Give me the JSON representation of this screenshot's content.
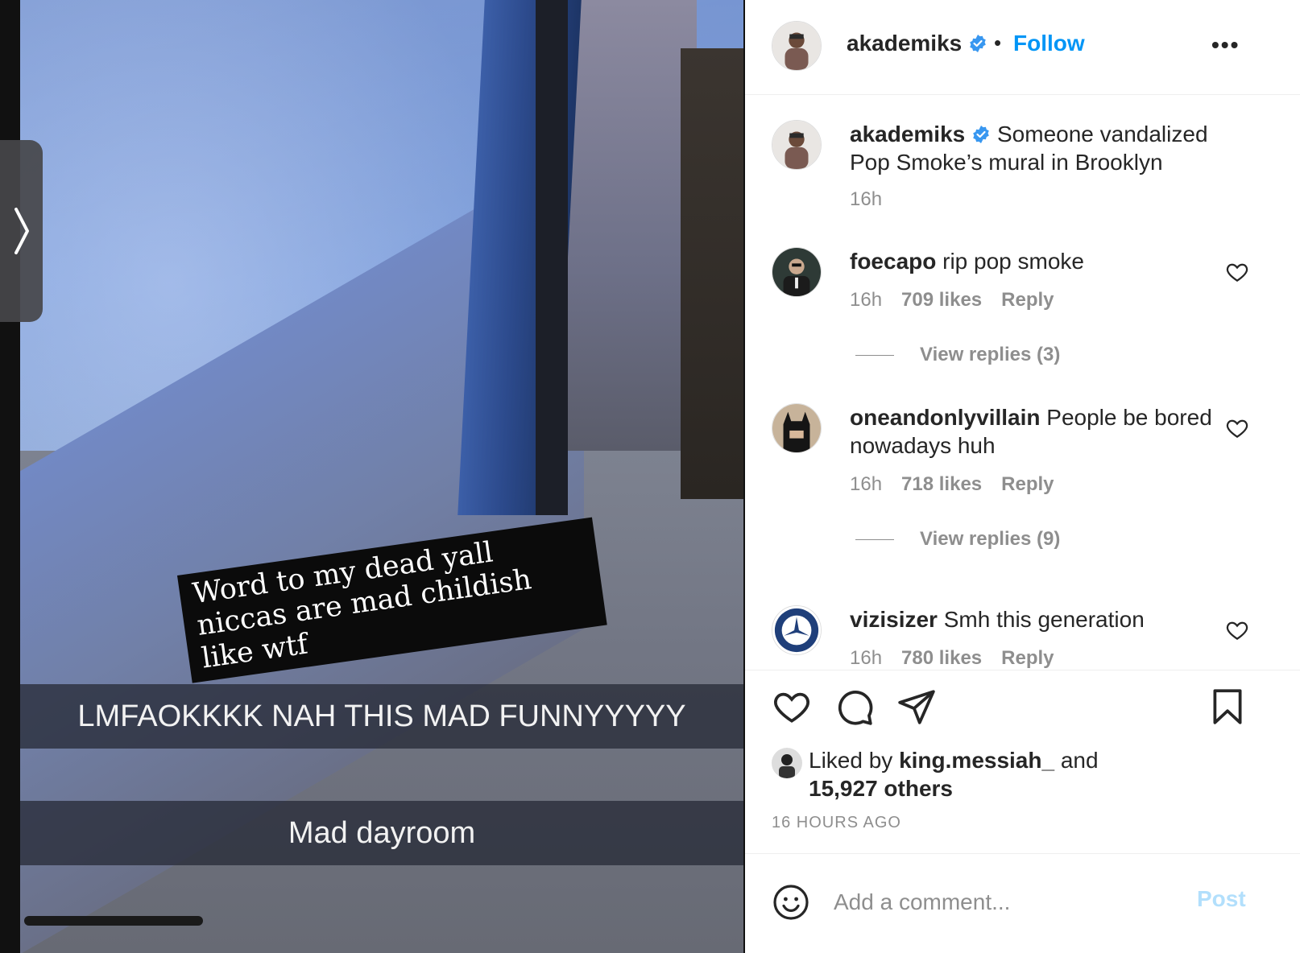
{
  "post": {
    "snap_sticker": "Word to my dead yall niccas are mad childish like wtf",
    "snap_caption_1": "LMFAOKKKK NAH THIS MAD FUNNYYYYY",
    "snap_caption_2": "Mad dayroom"
  },
  "header": {
    "username": "akademiks",
    "separator": "•",
    "follow_label": "Follow",
    "more_label": "•••"
  },
  "caption": {
    "username": "akademiks",
    "text": "Someone vandalized Pop Smoke’s mural in Brooklyn",
    "time": "16h"
  },
  "comments": [
    {
      "username": "foecapo",
      "text": "rip pop smoke",
      "time": "16h",
      "likes": "709 likes",
      "reply_label": "Reply",
      "view_replies": "View replies (3)"
    },
    {
      "username": "oneandonlyvillain",
      "text": "People be bored nowadays huh",
      "time": "16h",
      "likes": "718 likes",
      "reply_label": "Reply",
      "view_replies": "View replies (9)"
    },
    {
      "username": "vizisizer",
      "text": "Smh this generation",
      "time": "16h",
      "likes": "780 likes",
      "reply_label": "Reply"
    }
  ],
  "likes": {
    "prefix": "Liked by",
    "user": "king.messiah_",
    "conjunction": "and",
    "others": "15,927 others"
  },
  "timestamp": "16 HOURS AGO",
  "add_comment": {
    "placeholder": "Add a comment...",
    "post_label": "Post"
  },
  "colors": {
    "accent": "#0095f6",
    "verified": "#3897f0",
    "post_disabled": "#b2dffc",
    "meta_gray": "#8e8e8e"
  },
  "icons": [
    "chevron-right-icon",
    "verified-icon",
    "heart-icon",
    "comment-icon",
    "share-icon",
    "bookmark-icon",
    "smile-icon"
  ]
}
